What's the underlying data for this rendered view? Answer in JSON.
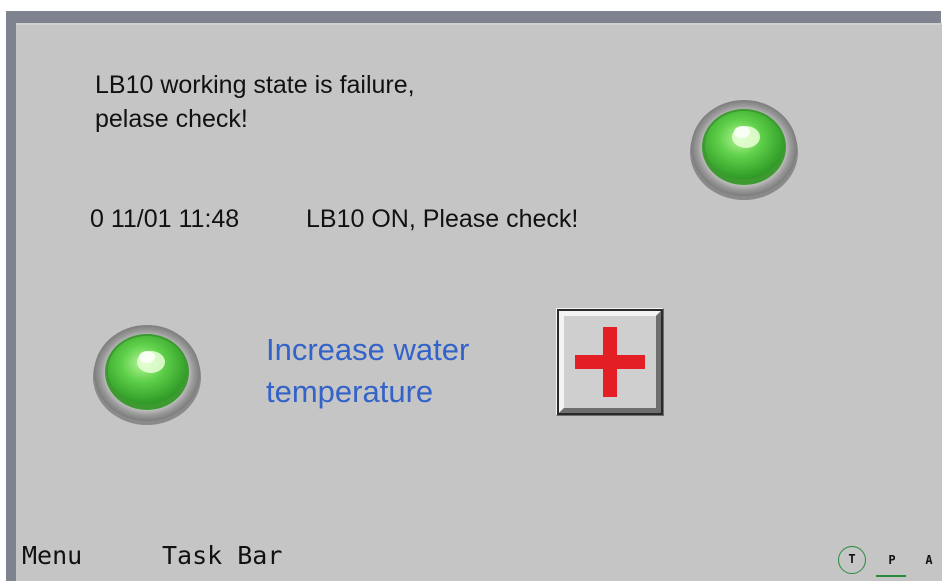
{
  "screen": {
    "message_line1": "LB10 working state is failure,",
    "message_line2": "pelase check!",
    "alarm": {
      "time": "0 11/01 11:48",
      "text": "LB10 ON, Please check!"
    },
    "label_line1": "Increase water",
    "label_line2": "temperature",
    "lamps": [
      {
        "name": "status-lamp-top",
        "state": "on",
        "color": "#44c23a"
      },
      {
        "name": "status-lamp-bottom",
        "state": "on",
        "color": "#44c23a"
      }
    ],
    "increase_button": {
      "icon": "plus-icon",
      "icon_color": "#e31e24"
    }
  },
  "taskbar": {
    "menu_label": "Menu",
    "task_bar_label": "Task Bar",
    "modes": {
      "t": "T",
      "p": "P",
      "a": "A"
    },
    "active_mode": "T"
  },
  "colors": {
    "screen_bg": "#c5c5c5",
    "frame": "#7f828f",
    "label_blue": "#3363c8",
    "lamp_green": "#44c23a"
  }
}
